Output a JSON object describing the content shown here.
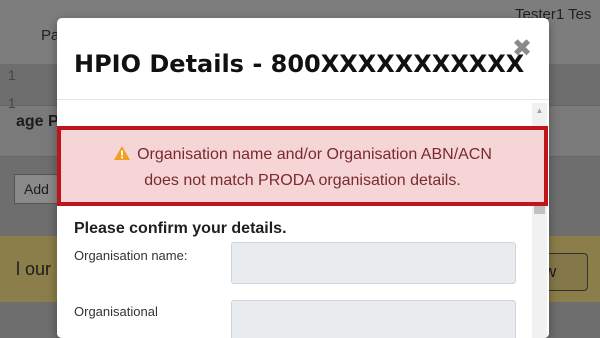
{
  "background": {
    "user": "Tester1 Tes",
    "nav_fragment": "Pa",
    "num1": "1",
    "num2": "1",
    "page_heading": "age P",
    "add_button": "Add",
    "banner_text": "l our",
    "banner_button": "w"
  },
  "modal": {
    "title": "HPIO Details - 800XXXXXXXXXXX",
    "close_symbol": "✖",
    "alert": {
      "line1": "Organisation name and/or Organisation ABN/ACN",
      "line2": "does not match PRODA organisation details.",
      "border_color": "#c0141b",
      "background_color": "#f6d5d7",
      "icon": "warning-icon",
      "icon_color": "#f0a020"
    },
    "form": {
      "heading": "Please confirm your details.",
      "org_name_label": "Organisation name:",
      "org_name_value": "",
      "orgal_label": "Organisational",
      "orgal_value": ""
    }
  }
}
